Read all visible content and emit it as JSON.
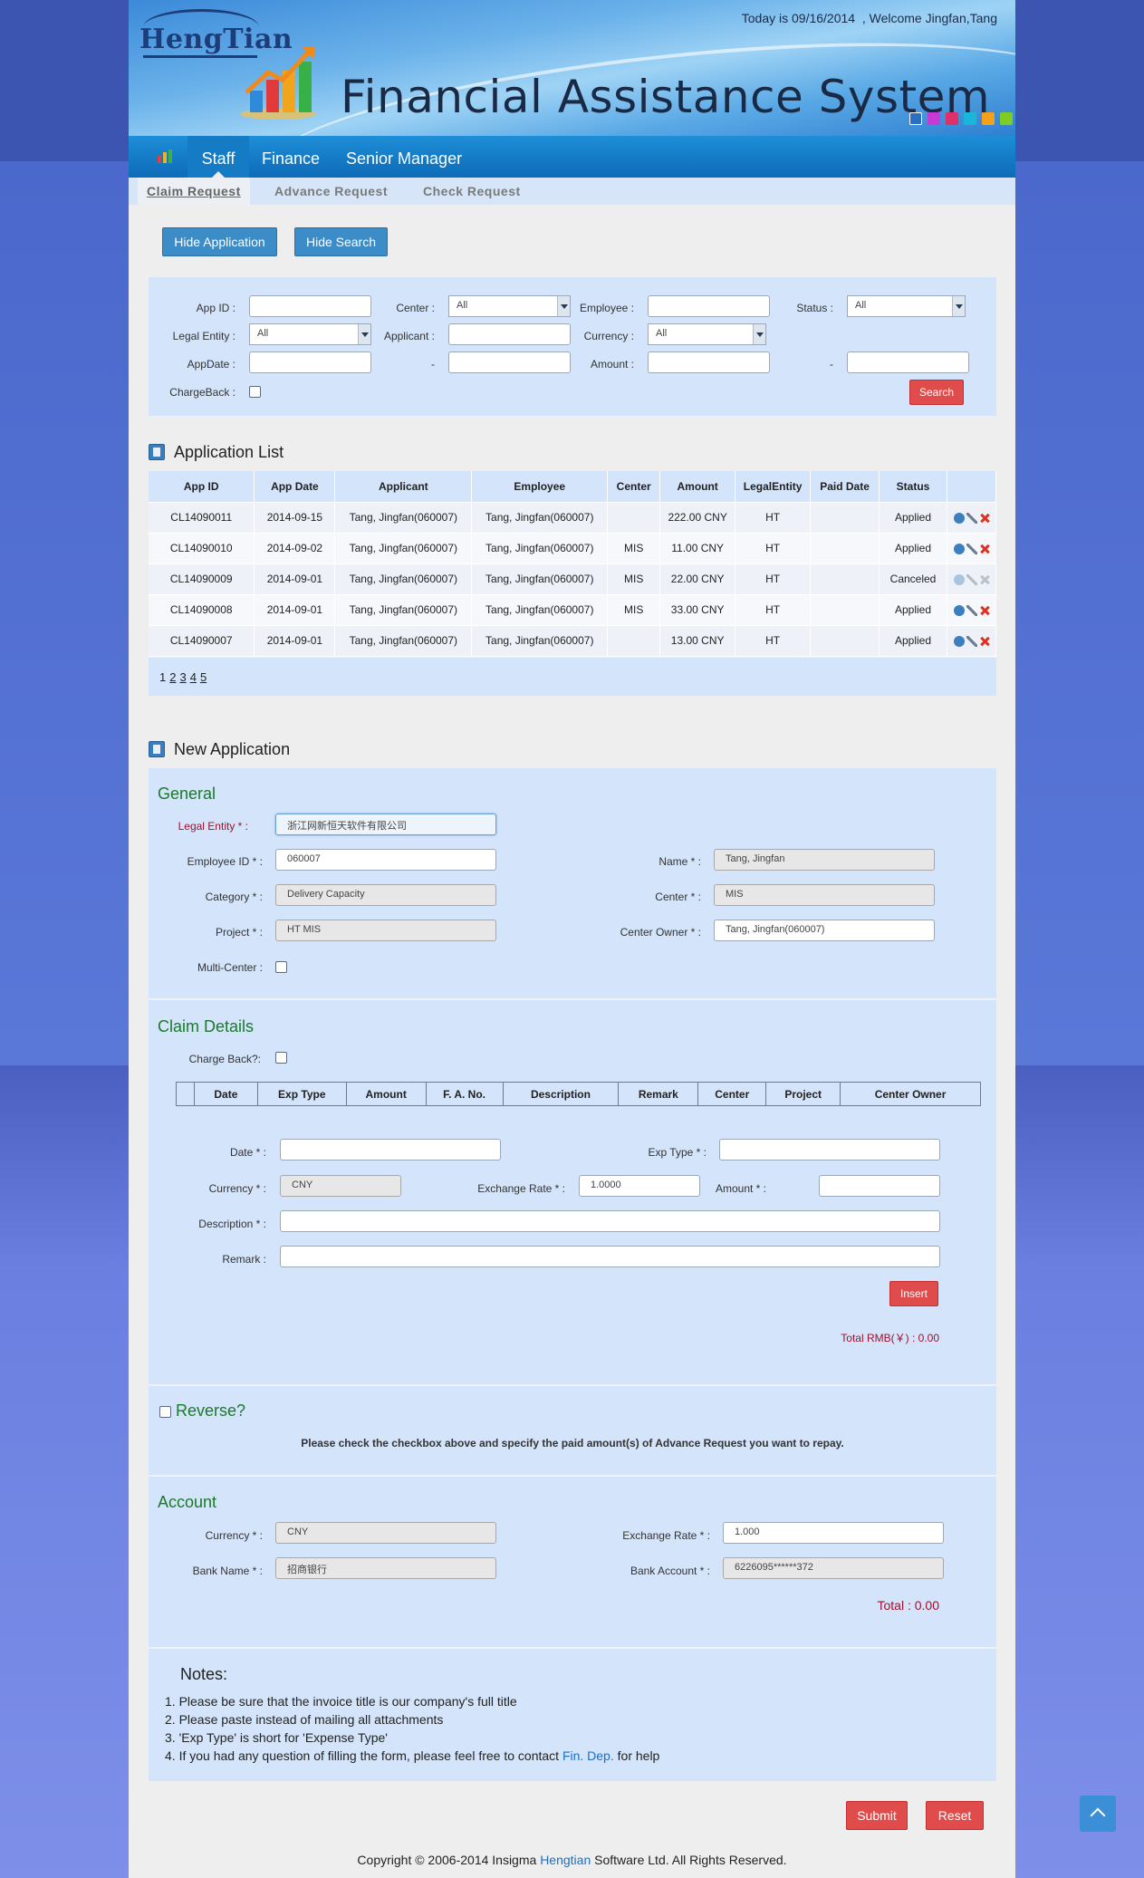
{
  "header": {
    "logo_text": "HengTian",
    "today_text": "Today is 09/16/2014  ,  Welcome Jingfan,Tang",
    "system_title": "Financial Assistance System",
    "theme_colors": [
      "#2b6fc2",
      "#c63ad8",
      "#e0306a",
      "#19b6d8",
      "#f3a11a",
      "#7fcc22"
    ]
  },
  "nav": {
    "items": [
      {
        "label": "Staff"
      },
      {
        "label": "Finance"
      },
      {
        "label": "Senior Manager"
      }
    ],
    "active": "Staff"
  },
  "subnav": {
    "items": [
      {
        "label": "Claim Request"
      },
      {
        "label": "Advance Request"
      },
      {
        "label": "Check Request"
      }
    ],
    "active": "Claim Request"
  },
  "actions": {
    "hide_application": "Hide Application",
    "hide_search": "Hide Search"
  },
  "search": {
    "app_id_label": "App ID :",
    "center_label": "Center :",
    "center_value": "All",
    "employee_label": "Employee :",
    "status_label": "Status :",
    "status_value": "All",
    "legal_entity_label": "Legal Entity :",
    "legal_entity_value": "All",
    "applicant_label": "Applicant :",
    "currency_label": "Currency :",
    "currency_value": "All",
    "appdate_label": "AppDate :",
    "dash1": "-",
    "amount_label": "Amount :",
    "dash2": "-",
    "chargeback_label": "ChargeBack :",
    "search_button": "Search"
  },
  "app_list": {
    "title": "Application List",
    "columns": [
      "App ID",
      "App Date",
      "Applicant",
      "Employee",
      "Center",
      "Amount",
      "LegalEntity",
      "Paid Date",
      "Status"
    ],
    "rows": [
      {
        "app_id": "CL14090011",
        "app_date": "2014-09-15",
        "applicant": "Tang, Jingfan(060007)",
        "employee": "Tang, Jingfan(060007)",
        "center": "",
        "amount": "222.00 CNY",
        "legal": "HT",
        "paid": "",
        "status": "Applied"
      },
      {
        "app_id": "CL14090010",
        "app_date": "2014-09-02",
        "applicant": "Tang, Jingfan(060007)",
        "employee": "Tang, Jingfan(060007)",
        "center": "MIS",
        "amount": "11.00 CNY",
        "legal": "HT",
        "paid": "",
        "status": "Applied"
      },
      {
        "app_id": "CL14090009",
        "app_date": "2014-09-01",
        "applicant": "Tang, Jingfan(060007)",
        "employee": "Tang, Jingfan(060007)",
        "center": "MIS",
        "amount": "22.00 CNY",
        "legal": "HT",
        "paid": "",
        "status": "Canceled"
      },
      {
        "app_id": "CL14090008",
        "app_date": "2014-09-01",
        "applicant": "Tang, Jingfan(060007)",
        "employee": "Tang, Jingfan(060007)",
        "center": "MIS",
        "amount": "33.00 CNY",
        "legal": "HT",
        "paid": "",
        "status": "Applied"
      },
      {
        "app_id": "CL14090007",
        "app_date": "2014-09-01",
        "applicant": "Tang, Jingfan(060007)",
        "employee": "Tang, Jingfan(060007)",
        "center": "",
        "amount": "13.00 CNY",
        "legal": "HT",
        "paid": "",
        "status": "Applied"
      }
    ],
    "pages": [
      "1",
      "2",
      "3",
      "4",
      "5"
    ]
  },
  "new_app": {
    "title": "New Application",
    "general": {
      "title": "General",
      "legal_entity_label": "Legal Entity",
      "legal_entity_value": "浙江网新恒天软件有限公司",
      "employee_id_label": "Employee ID",
      "employee_id_value": "060007",
      "name_label": "Name",
      "name_value": "Tang, Jingfan",
      "category_label": "Category",
      "category_value": "Delivery Capacity",
      "center_label": "Center",
      "center_value": "MIS",
      "project_label": "Project",
      "project_value": "HT MIS",
      "center_owner_label": "Center Owner",
      "center_owner_value": "Tang, Jingfan(060007)",
      "multi_center_label": "Multi-Center :"
    },
    "claim": {
      "title": "Claim Details",
      "chargeback_label": "Charge Back?:",
      "columns": [
        "Date",
        "Exp Type",
        "Amount",
        "F. A. No.",
        "Description",
        "Remark",
        "Center",
        "Project",
        "Center Owner"
      ],
      "date_label": "Date",
      "exp_type_label": "Exp Type",
      "currency_label": "Currency",
      "currency_value": "CNY",
      "exchange_rate_label": "Exchange Rate",
      "exchange_rate_value": "1.0000",
      "amount_label": "Amount",
      "description_label": "Description",
      "remark_label": "Remark :",
      "insert_button": "Insert",
      "total": "Total RMB(￥) : 0.00"
    },
    "reverse": {
      "title": "Reverse?",
      "hint": "Please check the checkbox above and specify the paid amount(s) of Advance Request you want to repay."
    },
    "account": {
      "title": "Account",
      "currency_label": "Currency",
      "currency_value": "CNY",
      "exchange_rate_label": "Exchange Rate",
      "exchange_rate_value": "1.000",
      "bank_name_label": "Bank Name",
      "bank_name_value": "招商银行",
      "bank_account_label": "Bank Account",
      "bank_account_value": "6226095******372",
      "total": "Total : 0.00"
    },
    "notes": {
      "title": "Notes:",
      "items": [
        "1. Please be sure that the invoice title is our company's full title",
        "2. Please paste instead of mailing all attachments",
        "3. 'Exp Type' is short for 'Expense Type'"
      ],
      "item4_prefix": "4. If you had any question of filling the form, please feel free to contact ",
      "item4_link": "Fin. Dep.",
      "item4_suffix": " for help"
    },
    "submit_button": "Submit",
    "reset_button": "Reset"
  },
  "footer": {
    "prefix": "Copyright © 2006-2014 Insigma ",
    "link": "Hengtian",
    "suffix": " Software Ltd. All Rights Reserved."
  }
}
